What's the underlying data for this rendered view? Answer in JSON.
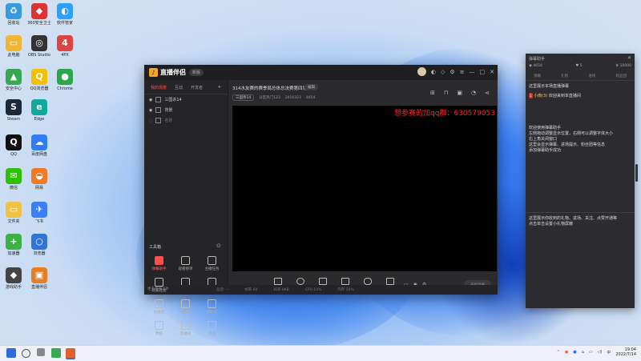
{
  "desktop": {
    "icons": [
      {
        "label": "回收站",
        "color": "#3a9adf",
        "glyph": "♻"
      },
      {
        "label": "360安全卫士",
        "color": "#d33",
        "glyph": "◆"
      },
      {
        "label": "软件管家",
        "color": "#2aa0ff",
        "glyph": "◐"
      },
      {
        "label": "4PX",
        "color": "#d44",
        "glyph": "4"
      },
      {
        "label": "此电脑",
        "color": "#f1b532",
        "glyph": "▭"
      },
      {
        "label": "OBS Studio",
        "color": "#333",
        "glyph": "◎"
      },
      {
        "label": "Chrome",
        "color": "#2aa64b",
        "glyph": "●"
      },
      {
        "label": "安全中心",
        "color": "#36a852",
        "glyph": "▲"
      },
      {
        "label": "QQ浏览器",
        "color": "#f3c000",
        "glyph": "Q"
      },
      {
        "label": "Steam",
        "color": "#1b2838",
        "glyph": "S"
      },
      {
        "label": "Edge",
        "color": "#13a89e",
        "glyph": "e"
      },
      {
        "label": "QQ",
        "color": "#111",
        "glyph": "Q"
      },
      {
        "label": "百度网盘",
        "color": "#2f7cf6",
        "glyph": "☁"
      },
      {
        "label": "微信",
        "color": "#2dc100",
        "glyph": "✉"
      },
      {
        "label": "网易",
        "color": "#f07a22",
        "glyph": "◒"
      },
      {
        "label": "文件夹",
        "color": "#f1c142",
        "glyph": "▭"
      },
      {
        "label": "飞书",
        "color": "#3b7ef5",
        "glyph": "✈"
      },
      {
        "label": "加速器",
        "color": "#3cb043",
        "glyph": "+"
      },
      {
        "label": "浏览器",
        "color": "#2f75d6",
        "glyph": "○"
      },
      {
        "label": "游戏助手",
        "color": "#444",
        "glyph": "◆"
      },
      {
        "label": "直播伴侣",
        "color": "#e67e22",
        "glyph": "▣"
      }
    ]
  },
  "window": {
    "logo": "直播伴侣",
    "version": "新版",
    "left_tabs": [
      "我的场景",
      "互动",
      "开发者"
    ],
    "scenes": [
      "三国杀14",
      "背景",
      "名称"
    ],
    "tools_header": "工具箱",
    "tools": [
      "弹幕助手",
      "观看榜单",
      "主播任务",
      "玩家连麦",
      "多人连麦",
      "推荐助手",
      "投放推",
      "礼物玩法",
      "弹幕库",
      "数据",
      "直播间",
      "更多"
    ],
    "left_footer": "更多直播工具请前往查看",
    "room_title": "314水友赛的赛季局总体总决赛第四场",
    "edit_label": "编辑",
    "room_meta": [
      "三国杀14",
      "分区热门123",
      "2416323",
      "4654"
    ],
    "overlay_text": "想参赛的加qq群：630579053",
    "bottom_tools": [
      "直播屏幕",
      "摄像头",
      "手机投屏",
      "多媒体",
      "麦克风",
      "扬声器"
    ],
    "start_label": "开始直播",
    "status_items": [
      "延迟: --",
      "帧率 60",
      "码率 0KB",
      "CPU 10%",
      "内存 56%"
    ]
  },
  "panel": {
    "title": "弹幕助手",
    "stats": [
      "4654",
      "5",
      "10000"
    ],
    "tabs": [
      "弹幕",
      "礼物",
      "进场",
      "粉丝团"
    ],
    "msg_system": "这里展示本场直播弹幕",
    "msg_user": "小南(3)",
    "msg_user_text": "欢迎来到本直播间",
    "msg_badge": "1",
    "welcome_lines": [
      "欢迎使用弹幕助手",
      "左侧拖动调整显示位置，右侧可以调整字体大小",
      "右上角关闭窗口",
      "这里会显示弹幕、进场提示、粉丝团等信息",
      "添加弹幕助手成功"
    ],
    "gift_lines": [
      "这里展示你收到的礼物、进场、关注、点赞开通等",
      "点击单击设置小礼物屏蔽"
    ]
  },
  "taskbar": {
    "time": "19:04",
    "date": "2022/7/14"
  }
}
